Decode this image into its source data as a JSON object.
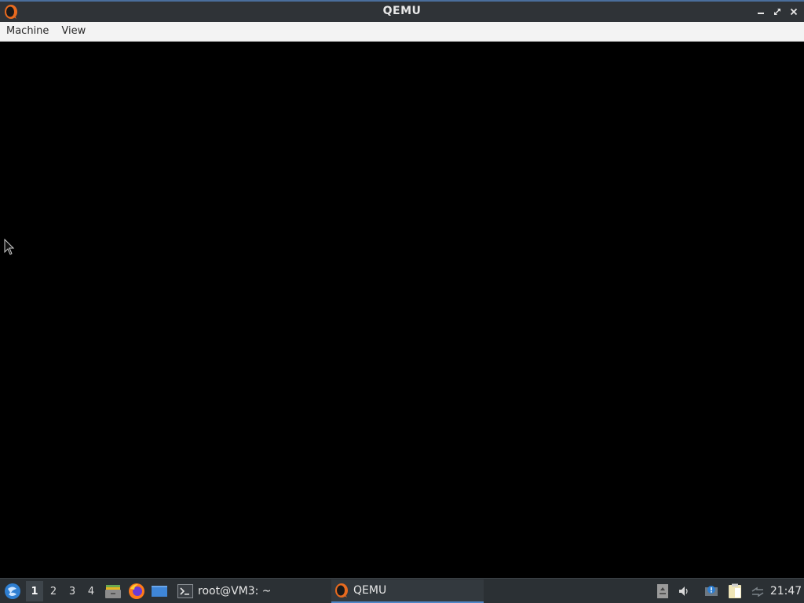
{
  "window": {
    "title": "QEMU",
    "accent_color": "#4a6e9c"
  },
  "menubar": {
    "items": [
      {
        "label": "Machine"
      },
      {
        "label": "View"
      }
    ]
  },
  "display": {
    "background": "#000000"
  },
  "taskbar": {
    "workspaces": [
      "1",
      "2",
      "3",
      "4"
    ],
    "active_workspace": "1",
    "launchers": [
      "file-manager-icon",
      "firefox-icon",
      "desktop-icon"
    ],
    "tasks": [
      {
        "label": "root@VM3: ~",
        "icon": "terminal-icon"
      },
      {
        "label": "QEMU",
        "icon": "qemu-icon",
        "active": true
      }
    ],
    "tray_icons": [
      "drive-icon",
      "volume-icon",
      "update-notifier-icon",
      "clipboard-icon",
      "network-icon"
    ],
    "clock": "21:47"
  }
}
